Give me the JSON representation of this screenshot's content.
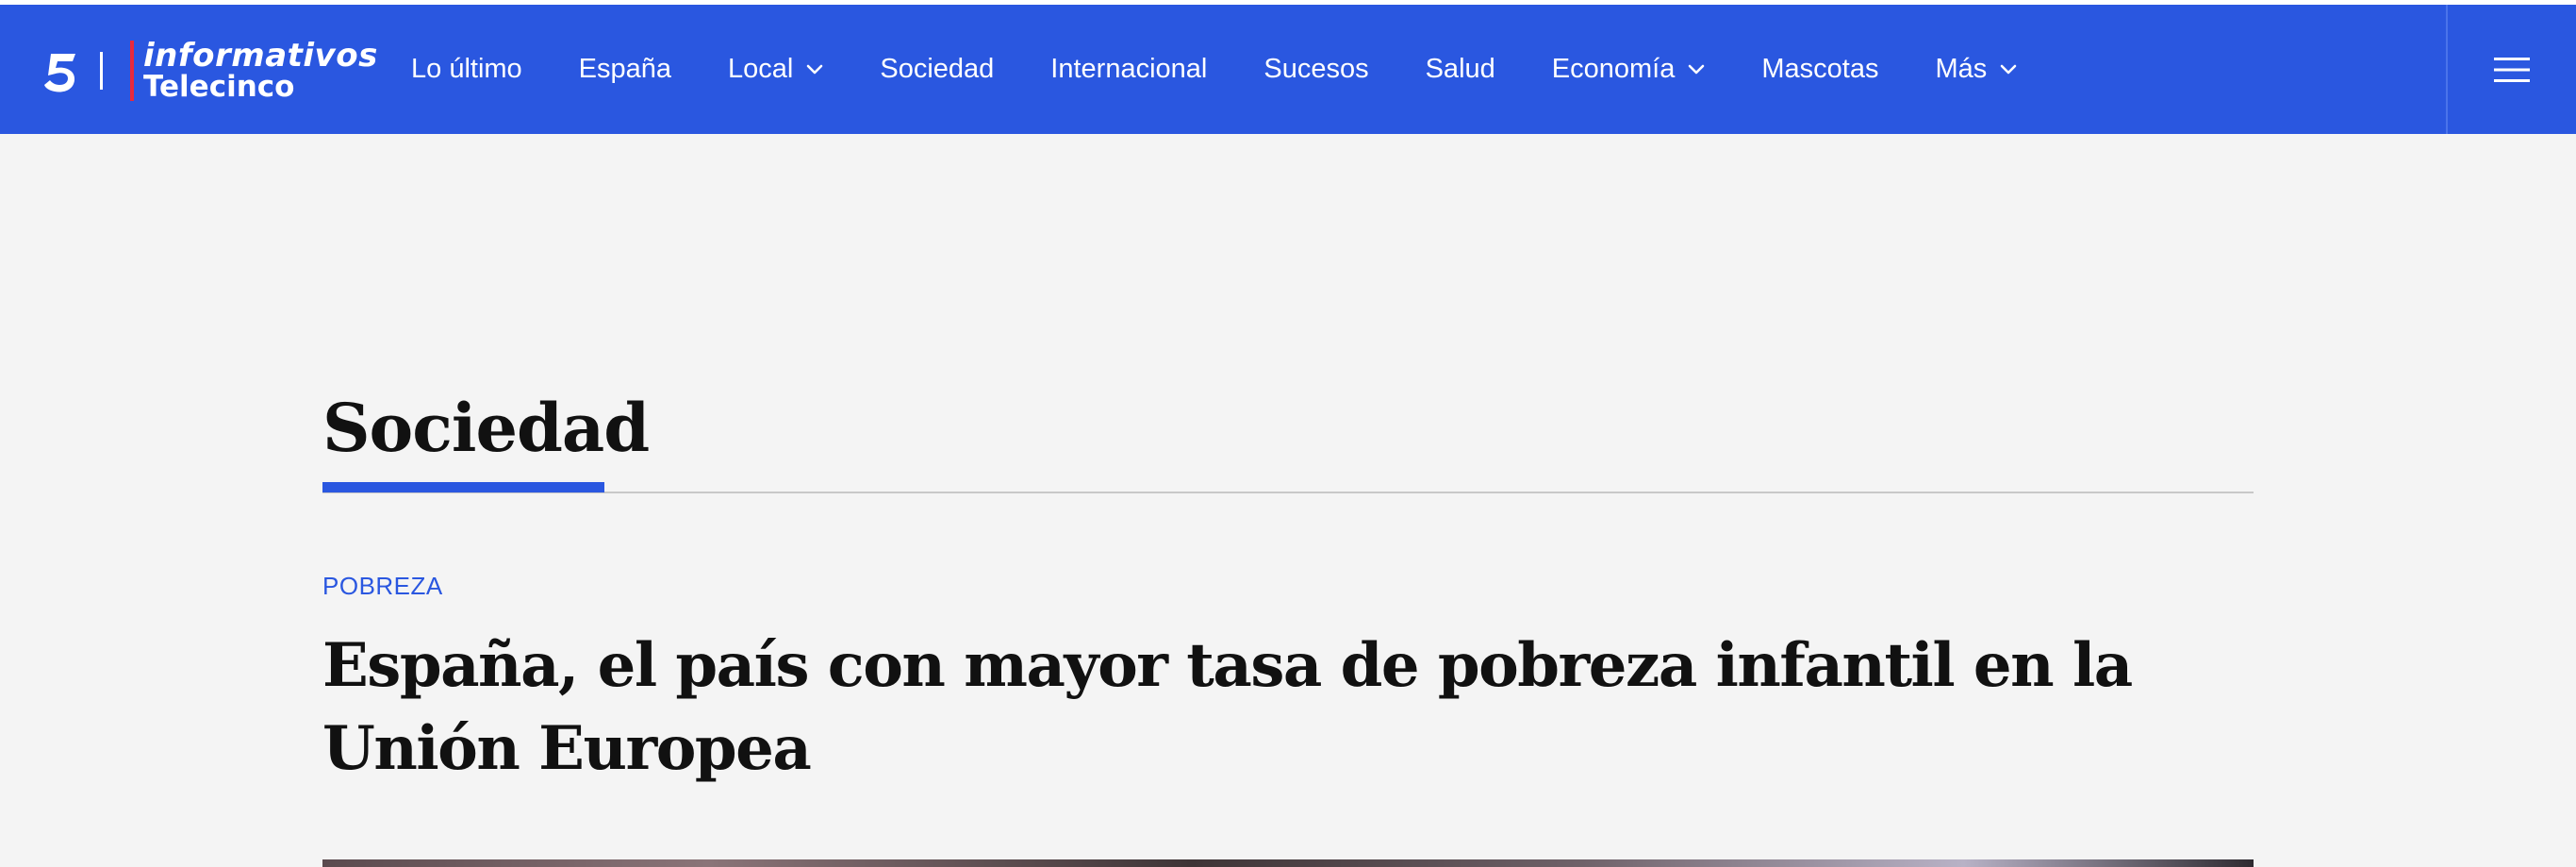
{
  "header": {
    "logo_line1": "informativos",
    "logo_line2": "Telecinco",
    "nav_items": [
      {
        "label": "Lo último",
        "has_dropdown": false
      },
      {
        "label": "España",
        "has_dropdown": false
      },
      {
        "label": "Local",
        "has_dropdown": true
      },
      {
        "label": "Sociedad",
        "has_dropdown": false
      },
      {
        "label": "Internacional",
        "has_dropdown": false
      },
      {
        "label": "Sucesos",
        "has_dropdown": false
      },
      {
        "label": "Salud",
        "has_dropdown": false
      },
      {
        "label": "Economía",
        "has_dropdown": true
      },
      {
        "label": "Mascotas",
        "has_dropdown": false
      },
      {
        "label": "Más",
        "has_dropdown": true
      }
    ],
    "menu_icon": "hamburger-menu-icon"
  },
  "section": {
    "title": "Sociedad"
  },
  "article": {
    "kicker": "POBREZA",
    "headline": "España, el país con mayor tasa de pobreza infantil en la Unión Europea"
  },
  "colors": {
    "brand_blue": "#2a57e0",
    "brand_red": "#e8293b",
    "background": "#f4f4f4"
  }
}
